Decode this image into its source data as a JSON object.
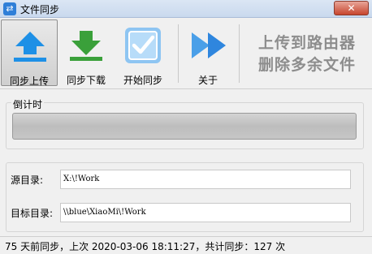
{
  "window": {
    "title": "文件同步",
    "close_label": "✕"
  },
  "toolbar": {
    "items": [
      {
        "label": "同步上传",
        "icon": "upload-arrow-icon"
      },
      {
        "label": "同步下载",
        "icon": "download-arrow-icon"
      },
      {
        "label": "开始同步",
        "icon": "checkbox-icon"
      },
      {
        "label": "关于",
        "icon": "fast-forward-icon"
      }
    ],
    "promo_line1": "上传到路由器",
    "promo_line2": "删除多余文件"
  },
  "countdown": {
    "label": "倒计时"
  },
  "fields": {
    "source_label": "源目录:",
    "source_value": "X:\\!Work",
    "target_label": "目标目录:",
    "target_value": "\\\\blue\\XiaoMi\\!Work"
  },
  "status": {
    "text": "75 天前同步，上次 2020-03-06 18:11:27，共计同步：127 次"
  },
  "colors": {
    "accent_blue": "#1e90e6",
    "download_green": "#3aa03a",
    "checkbox_blue": "#8ec5f2"
  }
}
